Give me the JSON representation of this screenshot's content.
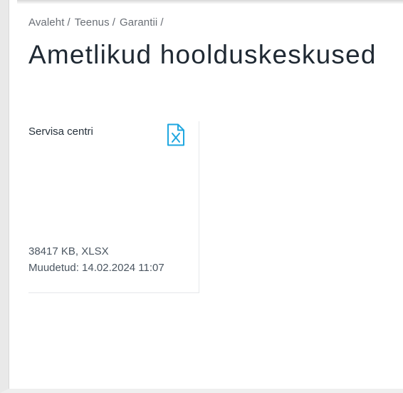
{
  "breadcrumb": {
    "items": [
      "Avaleht",
      "Teenus",
      "Garantii"
    ],
    "separator": "/"
  },
  "page": {
    "title": "Ametlikud hoolduskeskused"
  },
  "card": {
    "title": "Servisa centri",
    "file_size": "38417 KB, XLSX",
    "modified": "Muudetud: 14.02.2024 11:07",
    "icon": "xlsx-file-icon",
    "accent_color": "#1fa7e0"
  }
}
